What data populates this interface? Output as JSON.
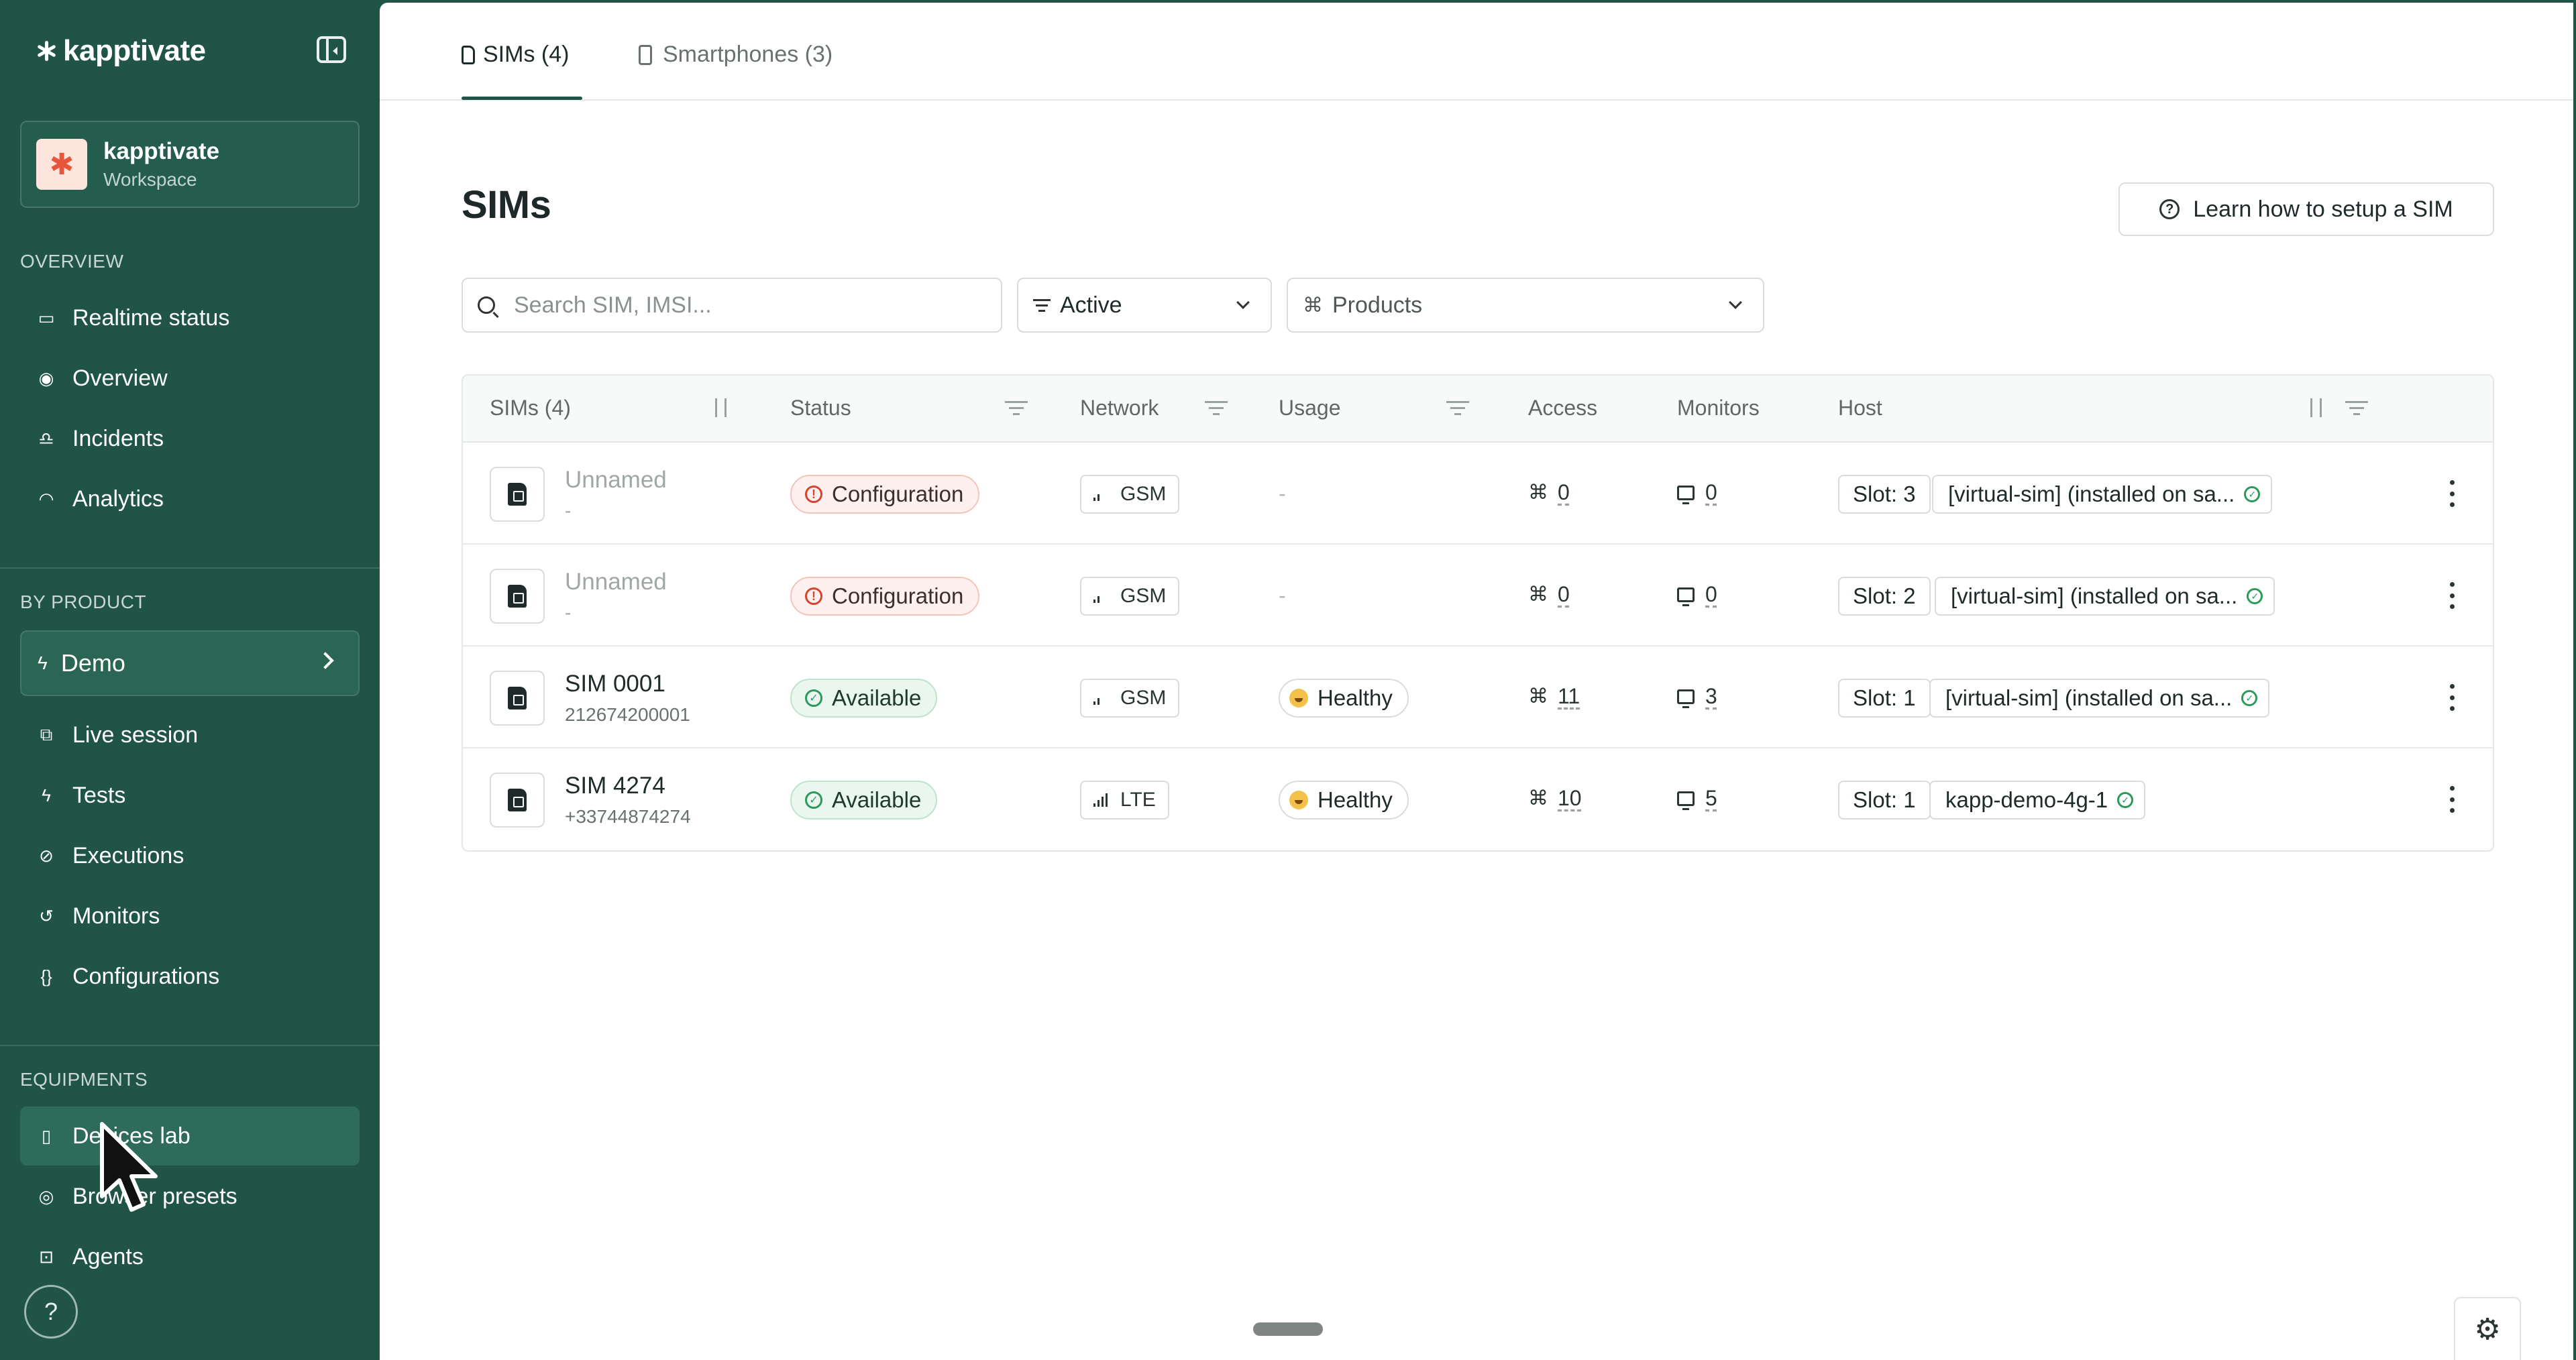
{
  "brand": {
    "name": "kapptivate"
  },
  "workspace": {
    "name": "kapptivate",
    "subtitle": "Workspace",
    "logo_color": "#e8553a"
  },
  "sidebar": {
    "overview_label": "OVERVIEW",
    "overview_items": [
      {
        "label": "Realtime status",
        "icon": "monitor-icon"
      },
      {
        "label": "Overview",
        "icon": "eye-icon"
      },
      {
        "label": "Incidents",
        "icon": "bell-icon"
      },
      {
        "label": "Analytics",
        "icon": "gauge-icon"
      }
    ],
    "by_product_label": "BY PRODUCT",
    "product_selected": "Demo",
    "product_items": [
      {
        "label": "Live session",
        "icon": "link-icon"
      },
      {
        "label": "Tests",
        "icon": "bolt-icon"
      },
      {
        "label": "Executions",
        "icon": "check-circle-icon"
      },
      {
        "label": "Monitors",
        "icon": "history-icon"
      },
      {
        "label": "Configurations",
        "icon": "braces-icon"
      }
    ],
    "equipments_label": "EQUIPMENTS",
    "equipment_items": [
      {
        "label": "Devices lab",
        "icon": "phone-icon",
        "active": true
      },
      {
        "label": "Browser presets",
        "icon": "chrome-icon"
      },
      {
        "label": "Agents",
        "icon": "bot-icon"
      }
    ],
    "help": "?"
  },
  "tabs": [
    {
      "label": "SIMs (4)",
      "active": true
    },
    {
      "label": "Smartphones (3)",
      "active": false
    }
  ],
  "page": {
    "title": "SIMs",
    "learn_button": "Learn how to setup a SIM"
  },
  "filters": {
    "search_placeholder": "Search SIM, IMSI...",
    "status_value": "Active",
    "products_placeholder": "Products"
  },
  "table": {
    "headers": {
      "sims": "SIMs (4)",
      "status": "Status",
      "network": "Network",
      "usage": "Usage",
      "access": "Access",
      "monitors": "Monitors",
      "host": "Host"
    },
    "rows": [
      {
        "name": "Unnamed",
        "sub": "-",
        "status": "Configuration",
        "network": "GSM",
        "signal_bars": 2,
        "usage": "-",
        "access": "0",
        "monitors": "0",
        "slot": "Slot: 3",
        "host": "[virtual-sim] (installed on sa..."
      },
      {
        "name": "Unnamed",
        "sub": "-",
        "status": "Configuration",
        "network": "GSM",
        "signal_bars": 2,
        "usage": "-",
        "access": "0",
        "monitors": "0",
        "slot": "Slot: 2",
        "host": "[virtual-sim] (installed on sa..."
      },
      {
        "name": "SIM 0001",
        "sub": "212674200001",
        "status": "Available",
        "network": "GSM",
        "signal_bars": 2,
        "usage": "Healthy",
        "access": "11",
        "monitors": "3",
        "slot": "Slot: 1",
        "host": "[virtual-sim] (installed on sa..."
      },
      {
        "name": "SIM 4274",
        "sub": "+33744874274",
        "status": "Available",
        "network": "LTE",
        "signal_bars": 4,
        "usage": "Healthy",
        "access": "10",
        "monitors": "5",
        "slot": "Slot: 1",
        "host": "kapp-demo-4g-1"
      }
    ]
  },
  "colors": {
    "sidebar_bg": "#1f5446",
    "config_badge": "#fdf0ee",
    "available_badge": "#eaf7ef",
    "ok_green": "#2d9a5d",
    "warn_red": "#d8422e"
  }
}
